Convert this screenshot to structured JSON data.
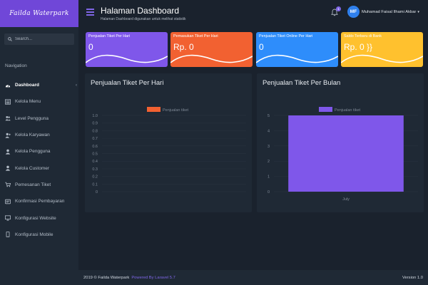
{
  "brand": {
    "name": "Failda Waterpark"
  },
  "search": {
    "placeholder": "Search..."
  },
  "sidebar": {
    "section_title": "Navigation",
    "items": [
      {
        "label": "Dashboard",
        "icon": "dashboard-icon",
        "active": true
      },
      {
        "label": "Kelola Menu",
        "icon": "menu-icon"
      },
      {
        "label": "Level Pengguna",
        "icon": "users-icon"
      },
      {
        "label": "Kelola Karyawan",
        "icon": "user-plus-icon"
      },
      {
        "label": "Kelola Pengguna",
        "icon": "user-icon"
      },
      {
        "label": "Kelola Customer",
        "icon": "user-icon"
      },
      {
        "label": "Pemesanan Tiket",
        "icon": "cart-icon"
      },
      {
        "label": "Konfirmasi Pembayaran",
        "icon": "receipt-icon"
      },
      {
        "label": "Konfigurasi Website",
        "icon": "monitor-icon"
      },
      {
        "label": "Konfigurasi Mobile",
        "icon": "mobile-icon"
      }
    ]
  },
  "header": {
    "title": "Halaman Dashboard",
    "subtitle": "Halaman Dashboard digunakan untuk melihat statistik",
    "notification_count": "1",
    "user_initials": "MF",
    "user_name": "Muhamad Faisal Ilhami Akbar"
  },
  "stats": [
    {
      "label": "Penjualan Tiket Per Hari",
      "value": "0",
      "color": "#7f57ea"
    },
    {
      "label": "Pemasukan Tiket Per Hari",
      "value": "Rp. 0",
      "color": "#f26131"
    },
    {
      "label": "Penjualan Tiket Online Per Hari",
      "value": "0",
      "color": "#2e8dfb"
    },
    {
      "label": "Saldo Terbaru di Bank",
      "value": "Rp. 0 }}",
      "color": "#ffc12e"
    }
  ],
  "chart_data": [
    {
      "type": "bar",
      "title": "Penjualan Tiket Per Hari",
      "series": [
        {
          "name": "Penjualan tiket",
          "values": []
        }
      ],
      "categories": [],
      "ylim": [
        0,
        1.0
      ],
      "yticks": [
        "1.0",
        "0.9",
        "0.8",
        "0.7",
        "0.6",
        "0.5",
        "0.4",
        "0.3",
        "0.2",
        "0.1",
        "0"
      ],
      "color": "#f26131",
      "legend": "top"
    },
    {
      "type": "bar",
      "title": "Penjualan Tiket Per Bulan",
      "series": [
        {
          "name": "Penjualan tiket",
          "values": [
            5
          ]
        }
      ],
      "categories": [
        "July"
      ],
      "ylim": [
        0,
        5
      ],
      "yticks": [
        "5",
        "4",
        "3",
        "2",
        "1",
        "0"
      ],
      "color": "#7f57ea",
      "legend": "top"
    }
  ],
  "footer": {
    "copyright": "2019 © Failda Waterpark",
    "powered": "Powered By Laravel 5.7",
    "version": "Version 1.0"
  }
}
